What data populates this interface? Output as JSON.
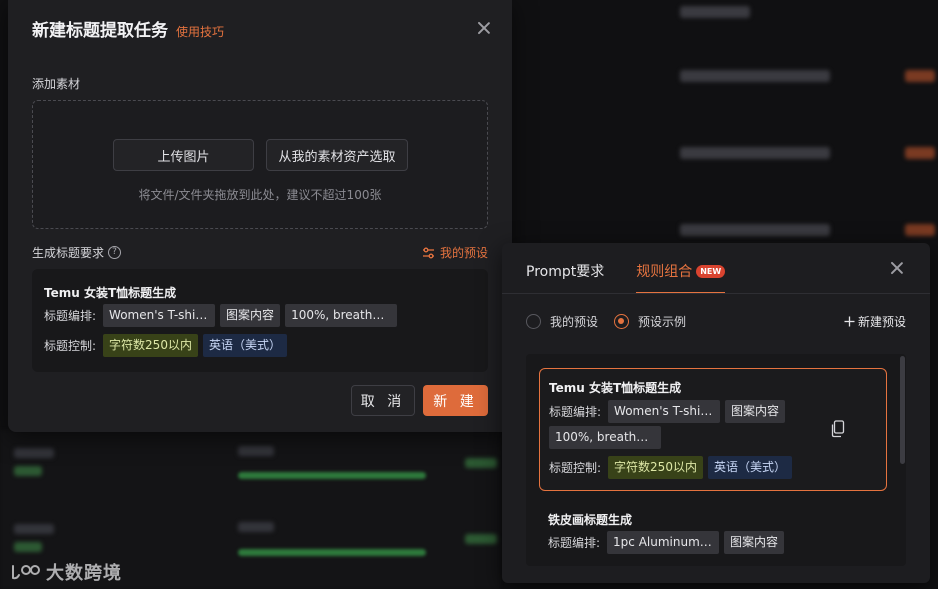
{
  "modal": {
    "title": "新建标题提取任务",
    "tips_link": "使用技巧",
    "add_material_label": "添加素材",
    "upload_button": "上传图片",
    "pick_assets_button": "从我的素材资产选取",
    "drop_hint": "将文件/文件夹拖放到此处，建议不超过100张",
    "requirements_label": "生成标题要求",
    "my_presets_link": "我的预设",
    "card": {
      "title": "Temu 女装T恤标题生成",
      "layout_label": "标题编排:",
      "layout_tags": [
        "Women's T-shir...",
        "图案内容",
        "100%, breatha..."
      ],
      "control_label": "标题控制:",
      "control_tags": [
        "字符数250以内",
        "英语（美式）"
      ]
    },
    "cancel_button": "取 消",
    "create_button": "新 建"
  },
  "panel": {
    "tabs": [
      {
        "label": "Prompt要求",
        "active": false
      },
      {
        "label": "规则组合",
        "active": true,
        "badge": "NEW"
      }
    ],
    "radio_my_presets": "我的预设",
    "radio_examples": "预设示例",
    "selected_radio": "预设示例",
    "new_preset_button": "新建预设",
    "preset_cards": [
      {
        "title": "Temu 女装T恤标题生成",
        "layout_label": "标题编排:",
        "layout_tags": [
          "Women's T-shir...",
          "图案内容",
          "100%, breatha..."
        ],
        "control_label": "标题控制:",
        "control_tags": [
          "字符数250以内",
          "英语（美式）"
        ],
        "selected": true
      },
      {
        "title": "铁皮画标题生成",
        "layout_label": "标题编排:",
        "layout_tags": [
          "1pc Aluminum ...",
          "图案内容"
        ]
      }
    ]
  },
  "watermark": {
    "text": "大数跨境"
  },
  "colors": {
    "accent": "#e5733f",
    "primary_button": "#de6b3b",
    "badge": "#d9432f",
    "tag_green": "#384218",
    "tag_blue": "#1d2a44",
    "tag_gray": "#35353a"
  },
  "icons": {
    "close": "close-icon",
    "help": "help-circle-icon",
    "presets": "sliders-icon",
    "copy": "copy-icon",
    "plus": "plus-icon",
    "logo": "brand-logo-icon"
  }
}
